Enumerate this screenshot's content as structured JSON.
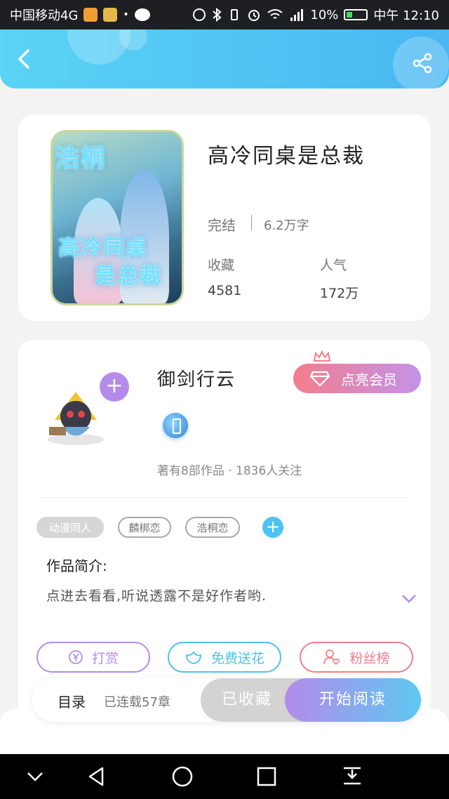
{
  "status_bar": {
    "carrier": "中国移动4G",
    "battery": "10%",
    "time": "中午 12:10"
  },
  "book": {
    "title": "高冷同桌是总裁",
    "cover_text_top": "浩桐",
    "cover_text_bottom_1": "高冷同桌",
    "cover_text_bottom_2": "是总裁",
    "status": "完结",
    "word_count": "6.2万字",
    "collect_label": "收藏",
    "collect_value": "4581",
    "popularity_label": "人气",
    "popularity_value": "172万"
  },
  "author": {
    "name": "御剑行云",
    "vip_label": "点亮会员",
    "meta": "著有8部作品 · 1836人关注",
    "follow_symbol": "+"
  },
  "tags": [
    {
      "label": "动漫同人"
    },
    {
      "label": "麟梆恋"
    },
    {
      "label": "浩桐恋"
    }
  ],
  "tag_add_symbol": "+",
  "intro": {
    "label": "作品简介:",
    "text": "点进去看看,听说透露不是好作者哟."
  },
  "actions": {
    "reward": "打赏",
    "flower": "免费送花",
    "fans": "粉丝榜"
  },
  "bottom_bar": {
    "toc": "目录",
    "serial": "已连载57章",
    "collected": "已收藏",
    "read": "开始阅读"
  },
  "colors": {
    "header_start": "#5ad3f5",
    "header_end": "#4ab7f2",
    "purple": "#b48bea",
    "cyan": "#4cc3e8",
    "pink": "#f07e8a"
  }
}
